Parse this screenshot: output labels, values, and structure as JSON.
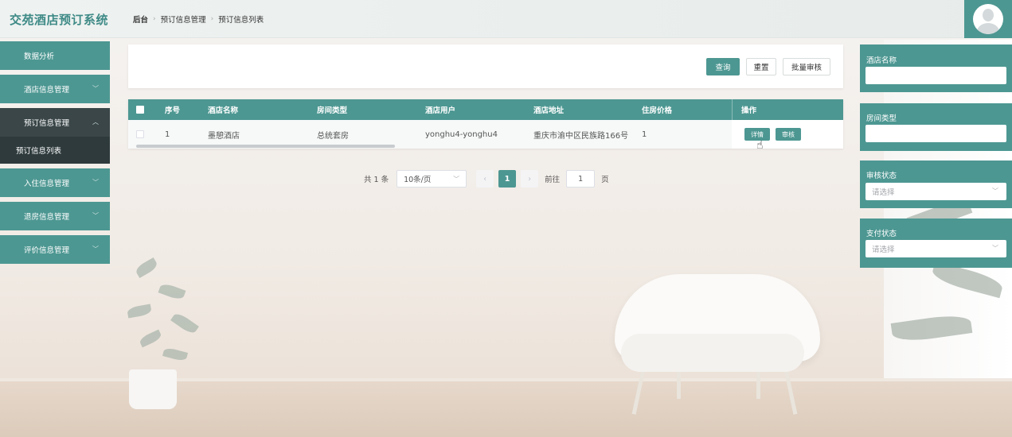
{
  "app": {
    "title": "交苑酒店预订系统"
  },
  "breadcrumb": {
    "root": "后台",
    "items": [
      "预订信息管理",
      "预订信息列表"
    ]
  },
  "sidebar": {
    "items": [
      {
        "label": "数据分析"
      },
      {
        "label": "酒店信息管理"
      },
      {
        "label": "预订信息管理"
      },
      {
        "label": "预订信息列表"
      },
      {
        "label": "入住信息管理"
      },
      {
        "label": "退房信息管理"
      },
      {
        "label": "评价信息管理"
      }
    ]
  },
  "search": {
    "query_label": "查询",
    "reset_label": "重置",
    "batch_label": "批量审核"
  },
  "table": {
    "headers": [
      "序号",
      "酒店名称",
      "房间类型",
      "酒店用户",
      "酒店地址",
      "住房价格",
      "操作"
    ],
    "rows": [
      {
        "index": "1",
        "hotel": "墨憩酒店",
        "room": "总统套房",
        "user": "yonghu4-yonghu4",
        "address": "重庆市渝中区民族路166号",
        "price": "1"
      }
    ],
    "actions": {
      "detail": "详情",
      "review": "审核"
    }
  },
  "pagination": {
    "total_text": "共 1 条",
    "page_size": "10条/页",
    "prev": "‹",
    "next": "›",
    "current_page": "1",
    "goto_label": "前往",
    "goto_value": "1",
    "page_suffix": "页"
  },
  "filters": [
    {
      "label": "酒店名称",
      "value": ""
    },
    {
      "label": "房间类型",
      "value": ""
    },
    {
      "label": "审核状态",
      "placeholder": "请选择"
    },
    {
      "label": "支付状态",
      "placeholder": "请选择"
    }
  ],
  "colors": {
    "accent": "#4d9792",
    "brand_text": "#3e8a86",
    "sidebar_active": "#3a4648",
    "sidebar_sub": "#2e3a3c"
  }
}
